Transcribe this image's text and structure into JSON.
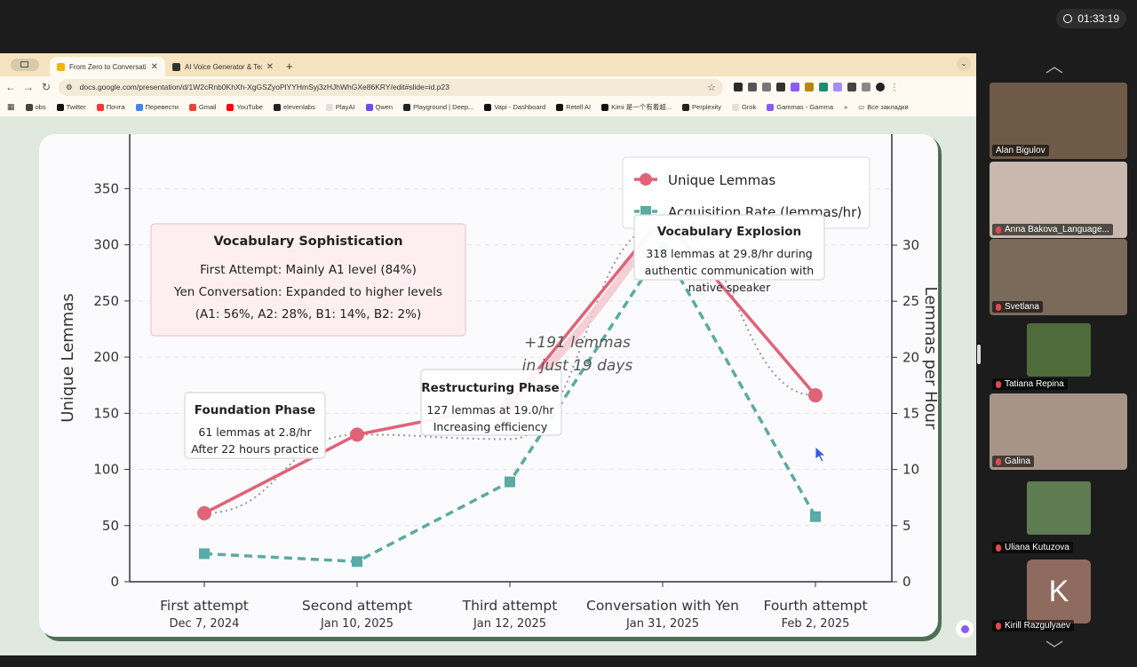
{
  "meeting": {
    "timer": "01:33:19"
  },
  "browser": {
    "tabs": [
      {
        "label": "From Zero to Conversational",
        "active": true,
        "favicon_color": "#f5b400"
      },
      {
        "label": "AI Voice Generator & Text to",
        "active": false,
        "favicon_color": "#333333"
      }
    ],
    "url": "docs.google.com/presentation/d/1W2cRnb0KhXh-XgGSZyoPlYYHmSyj3zHJhWhGXe86KRY/edit#slide=id.p23",
    "bookmarks": [
      {
        "label": "obs",
        "color": "#444444"
      },
      {
        "label": "Twitter",
        "color": "#111111"
      },
      {
        "label": "Почта",
        "color": "#ff3333"
      },
      {
        "label": "Перевести",
        "color": "#4285f4"
      },
      {
        "label": "Gmail",
        "color": "#ea4335"
      },
      {
        "label": "YouTube",
        "color": "#ff0000"
      },
      {
        "label": "elevenlabs",
        "color": "#222222"
      },
      {
        "label": "PlayAI",
        "color": "#e0e0e0"
      },
      {
        "label": "Qwen",
        "color": "#6c4cf0"
      },
      {
        "label": "Playground | Deep...",
        "color": "#222222"
      },
      {
        "label": "Vapi - Dashboard",
        "color": "#111111"
      },
      {
        "label": "Retell AI",
        "color": "#111111"
      },
      {
        "label": "Kimi 是一个有着超...",
        "color": "#111111"
      },
      {
        "label": "Perplexity",
        "color": "#222222"
      },
      {
        "label": "Grok",
        "color": "#e0e0e0"
      },
      {
        "label": "Gammas - Gamma",
        "color": "#8a5cf6"
      }
    ],
    "bookmarks_more": "»",
    "all_bookmarks": "Все закладки"
  },
  "chart_data": {
    "type": "line",
    "categories": [
      "First attempt",
      "Second attempt",
      "Third attempt",
      "Conversation with Yen",
      "Fourth attempt"
    ],
    "dates": [
      "Dec 7, 2024",
      "Jan 10, 2025",
      "Jan 12, 2025",
      "Jan 31, 2025",
      "Feb 2, 2025"
    ],
    "series": [
      {
        "name": "Unique Lemmas",
        "axis": "left",
        "values": [
          61,
          131,
          158,
          325,
          166
        ],
        "color": "#e06377"
      },
      {
        "name": "Acquisition Rate (lemmas/hr)",
        "axis": "right",
        "values": [
          2.5,
          1.8,
          8.9,
          29.8,
          5.8
        ],
        "color": "#5aaaa5"
      }
    ],
    "trend_values": [
      61,
      131,
      127,
      318,
      166
    ],
    "ylabel": "Unique Lemmas",
    "ylabel_right": "Lemmas per Hour",
    "ylim": [
      0,
      400
    ],
    "ylim_right": [
      0,
      33
    ],
    "yticks": [
      0,
      50,
      100,
      150,
      200,
      250,
      300,
      350
    ],
    "yticks_right": [
      0,
      5,
      10,
      15,
      20,
      25,
      30
    ],
    "grid": true,
    "legend_placement": "top-right",
    "annotations": {
      "sophistication": {
        "title": "Vocabulary Sophistication",
        "lines": [
          "First Attempt: Mainly A1 level (84%)",
          "Yen Conversation: Expanded to higher levels",
          "(A1: 56%, A2: 28%, B1: 14%, B2: 2%)"
        ]
      },
      "foundation": {
        "title": "Foundation Phase",
        "lines": [
          "61 lemmas at 2.8/hr",
          "After 22 hours practice"
        ]
      },
      "restructuring": {
        "title": "Restructuring Phase",
        "lines": [
          "127 lemmas at 19.0/hr",
          "Increasing efficiency"
        ]
      },
      "explosion": {
        "title": "Vocabulary Explosion",
        "lines": [
          "318 lemmas at 29.8/hr during",
          "authentic communication with",
          "native speaker"
        ]
      },
      "growth": [
        "+191 lemmas",
        "in just 19 days"
      ]
    }
  },
  "participants": [
    {
      "name": "Alan Bigulov",
      "speaking": true,
      "muted": false,
      "bg": "#6f5a48"
    },
    {
      "name": "Anna Bakova_Language...",
      "speaking": false,
      "muted": true,
      "bg": "#c9b8ad"
    },
    {
      "name": "Svetlana",
      "speaking": false,
      "muted": true,
      "bg": "#7a6a5a"
    },
    {
      "name": "Tatiana Repina",
      "speaking": false,
      "muted": true,
      "bg": "#4f6b3a"
    },
    {
      "name": "Galina",
      "speaking": false,
      "muted": true,
      "bg": "#a79486"
    },
    {
      "name": "Uliana Kutuzova",
      "speaking": false,
      "muted": true,
      "bg": "#5e7c52"
    },
    {
      "name": "Kirill Razgulyaev",
      "speaking": false,
      "muted": true,
      "bg": "#2a2a2a",
      "initial": "K",
      "initial_bg": "#8f6a5f"
    }
  ]
}
